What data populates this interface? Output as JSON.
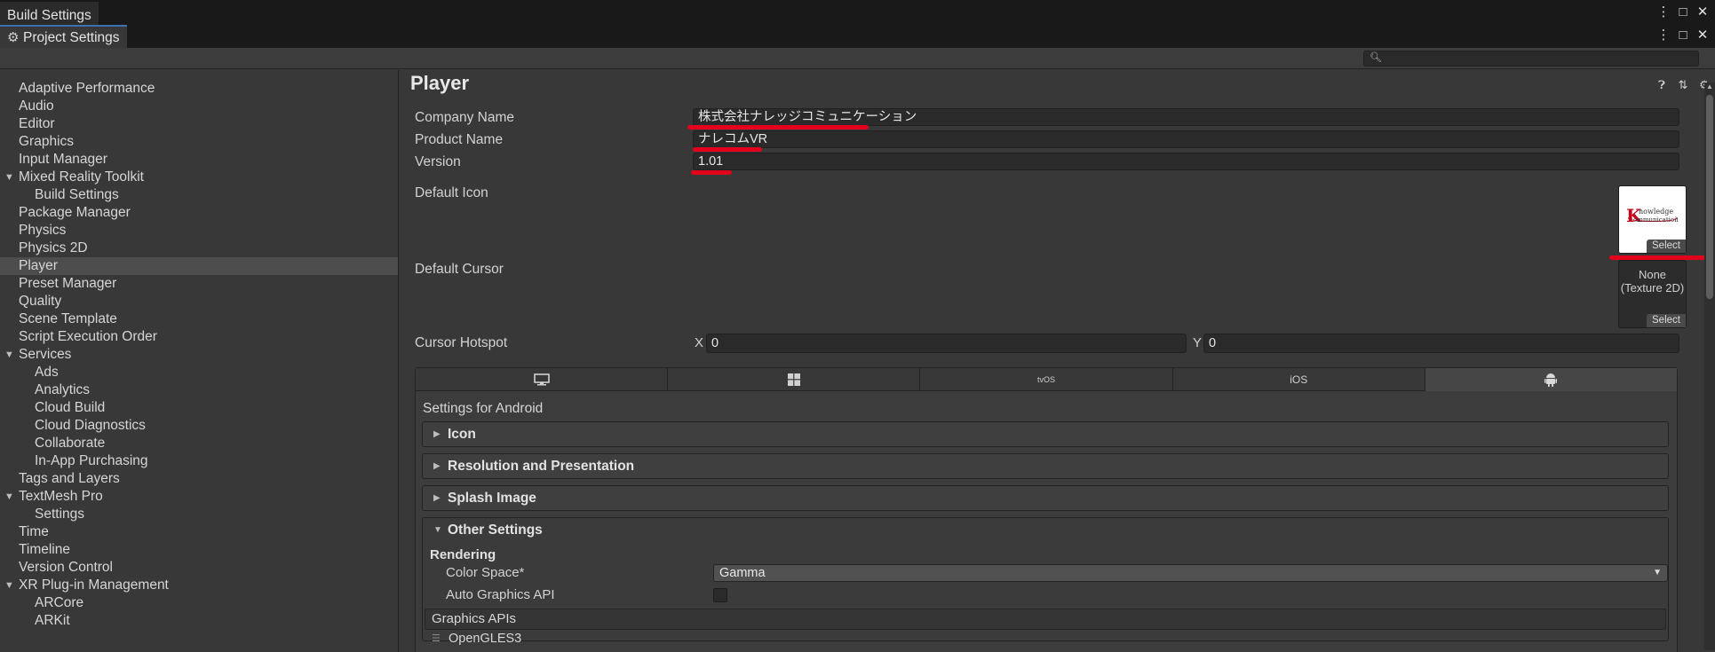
{
  "tabs": {
    "build_settings": "Build Settings",
    "project_settings": "Project Settings"
  },
  "window_controls": {
    "menu": "⋮",
    "maximize": "□",
    "close": "✕"
  },
  "search": {
    "placeholder": "",
    "value": ""
  },
  "sidebar": {
    "items": [
      {
        "label": "Adaptive Performance",
        "level": 0
      },
      {
        "label": "Audio",
        "level": 0
      },
      {
        "label": "Editor",
        "level": 0
      },
      {
        "label": "Graphics",
        "level": 0
      },
      {
        "label": "Input Manager",
        "level": 0
      },
      {
        "label": "Mixed Reality Toolkit",
        "level": 0,
        "expanded": true
      },
      {
        "label": "Build Settings",
        "level": 1
      },
      {
        "label": "Package Manager",
        "level": 0
      },
      {
        "label": "Physics",
        "level": 0
      },
      {
        "label": "Physics 2D",
        "level": 0
      },
      {
        "label": "Player",
        "level": 0,
        "selected": true
      },
      {
        "label": "Preset Manager",
        "level": 0
      },
      {
        "label": "Quality",
        "level": 0
      },
      {
        "label": "Scene Template",
        "level": 0
      },
      {
        "label": "Script Execution Order",
        "level": 0
      },
      {
        "label": "Services",
        "level": 0,
        "expanded": true
      },
      {
        "label": "Ads",
        "level": 1
      },
      {
        "label": "Analytics",
        "level": 1
      },
      {
        "label": "Cloud Build",
        "level": 1
      },
      {
        "label": "Cloud Diagnostics",
        "level": 1
      },
      {
        "label": "Collaborate",
        "level": 1
      },
      {
        "label": "In-App Purchasing",
        "level": 1
      },
      {
        "label": "Tags and Layers",
        "level": 0
      },
      {
        "label": "TextMesh Pro",
        "level": 0,
        "expanded": true
      },
      {
        "label": "Settings",
        "level": 1
      },
      {
        "label": "Time",
        "level": 0
      },
      {
        "label": "Timeline",
        "level": 0
      },
      {
        "label": "Version Control",
        "level": 0
      },
      {
        "label": "XR Plug-in Management",
        "level": 0,
        "expanded": true
      },
      {
        "label": "ARCore",
        "level": 1
      },
      {
        "label": "ARKit",
        "level": 1
      }
    ]
  },
  "player": {
    "title": "Player",
    "company_name_label": "Company Name",
    "company_name_value": "株式会社ナレッジコミュニケーション",
    "product_name_label": "Product Name",
    "product_name_value": "ナレコムVR",
    "version_label": "Version",
    "version_value": "1.01",
    "default_icon_label": "Default Icon",
    "default_icon_select": "Select",
    "default_cursor_label": "Default Cursor",
    "default_cursor_none_line1": "None",
    "default_cursor_none_line2": "(Texture 2D)",
    "default_cursor_select": "Select",
    "cursor_hotspot_label": "Cursor Hotspot",
    "hotspot_x_label": "X",
    "hotspot_x_value": "0",
    "hotspot_y_label": "Y",
    "hotspot_y_value": "0",
    "icon_logo_letter": "K",
    "icon_logo_word1": "nowledge",
    "icon_logo_word2": "ommunication"
  },
  "platform_tabs": [
    {
      "icon": "monitor-icon",
      "label": ""
    },
    {
      "icon": "windows-icon",
      "label": ""
    },
    {
      "icon": "tvos-icon",
      "label": "tvOS"
    },
    {
      "icon": "ios-icon",
      "label": "iOS"
    },
    {
      "icon": "android-icon",
      "label": "",
      "active": true
    }
  ],
  "settings": {
    "settings_for": "Settings for Android",
    "sections": {
      "icon": "Icon",
      "resolution": "Resolution and Presentation",
      "splash": "Splash Image",
      "other": "Other Settings"
    },
    "rendering_label": "Rendering",
    "color_space_label": "Color Space*",
    "color_space_value": "Gamma",
    "auto_graphics_label": "Auto Graphics API",
    "auto_graphics_checked": false,
    "graphics_apis_label": "Graphics APIs",
    "graphics_api_item": "OpenGLES3"
  },
  "colors": {
    "accent_tab": "#3a72b0",
    "annotation_red": "#e3001b",
    "panel_bg": "#383838",
    "field_bg": "#2a2a2a"
  }
}
